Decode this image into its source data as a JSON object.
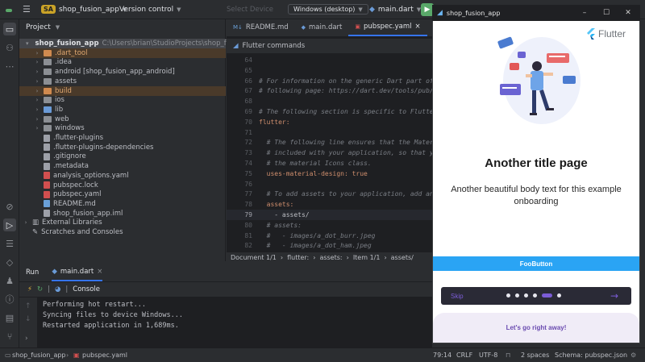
{
  "toolbar": {
    "project_badge": "SA",
    "project_name": "shop_fusion_app",
    "vcs_label": "Version control",
    "device_placeholder": "Select Device",
    "device_selected": "Windows (desktop)",
    "run_config": "main.dart"
  },
  "project_panel": {
    "title": "Project",
    "root_name": "shop_fusion_app",
    "root_path": "C:\\Users\\brian\\StudioProjects\\shop_fusion_app",
    "items": [
      {
        "label": ".dart_tool",
        "type": "folder",
        "color": "orange",
        "expandable": true
      },
      {
        "label": ".idea",
        "type": "folder",
        "color": "grey",
        "expandable": true
      },
      {
        "label": "android [shop_fusion_app_android]",
        "type": "folder",
        "color": "grey",
        "expandable": true
      },
      {
        "label": "assets",
        "type": "folder",
        "color": "grey",
        "expandable": true
      },
      {
        "label": "build",
        "type": "folder",
        "color": "orange",
        "expandable": true
      },
      {
        "label": "ios",
        "type": "folder",
        "color": "grey",
        "expandable": true
      },
      {
        "label": "lib",
        "type": "folder",
        "color": "blue",
        "expandable": true
      },
      {
        "label": "web",
        "type": "folder",
        "color": "grey",
        "expandable": true
      },
      {
        "label": "windows",
        "type": "folder",
        "color": "grey",
        "expandable": true
      },
      {
        "label": ".flutter-plugins",
        "type": "file",
        "color": "grey"
      },
      {
        "label": ".flutter-plugins-dependencies",
        "type": "file",
        "color": "grey"
      },
      {
        "label": ".gitignore",
        "type": "file",
        "color": "grey"
      },
      {
        "label": ".metadata",
        "type": "file",
        "color": "grey"
      },
      {
        "label": "analysis_options.yaml",
        "type": "file",
        "color": "red"
      },
      {
        "label": "pubspec.lock",
        "type": "file",
        "color": "red"
      },
      {
        "label": "pubspec.yaml",
        "type": "file",
        "color": "red"
      },
      {
        "label": "README.md",
        "type": "file",
        "color": "md"
      },
      {
        "label": "shop_fusion_app.iml",
        "type": "file",
        "color": "grey"
      }
    ],
    "external_libraries": "External Libraries",
    "scratches": "Scratches and Consoles"
  },
  "editor": {
    "tabs": [
      {
        "label": "README.md",
        "icon": "markdown-icon",
        "active": false
      },
      {
        "label": "main.dart",
        "icon": "dart-icon",
        "active": false
      },
      {
        "label": "pubspec.yaml",
        "icon": "yaml-icon",
        "active": true
      }
    ],
    "flutter_commands": "Flutter commands",
    "lines": [
      {
        "n": "64",
        "text": "",
        "kind": "plain"
      },
      {
        "n": "65",
        "text": "",
        "kind": "plain"
      },
      {
        "n": "66",
        "text": "# For information on the generic Dart part of",
        "kind": "comment"
      },
      {
        "n": "67",
        "text": "# following page: https://dart.dev/tools/pub/",
        "kind": "comment"
      },
      {
        "n": "68",
        "text": "",
        "kind": "plain"
      },
      {
        "n": "69",
        "text": "# The following section is specific to Flutte",
        "kind": "comment"
      },
      {
        "n": "70",
        "text": "flutter:",
        "kind": "key"
      },
      {
        "n": "71",
        "text": "",
        "kind": "plain"
      },
      {
        "n": "72",
        "text": "  # The following line ensures that the Mater",
        "kind": "comment"
      },
      {
        "n": "73",
        "text": "  # included with your application, so that y",
        "kind": "comment"
      },
      {
        "n": "74",
        "text": "  # the material Icons class.",
        "kind": "comment"
      },
      {
        "n": "75",
        "text": "  uses-material-design: true",
        "kind": "keyval"
      },
      {
        "n": "76",
        "text": "",
        "kind": "plain"
      },
      {
        "n": "77",
        "text": "  # To add assets to your application, add an",
        "kind": "comment"
      },
      {
        "n": "78",
        "text": "  assets:",
        "kind": "key"
      },
      {
        "n": "79",
        "text": "    - assets/",
        "kind": "plain"
      },
      {
        "n": "80",
        "text": "  # assets:",
        "kind": "comment"
      },
      {
        "n": "81",
        "text": "  #   - images/a_dot_burr.jpeg",
        "kind": "comment"
      },
      {
        "n": "82",
        "text": "  #   - images/a_dot_ham.jpeg",
        "kind": "comment"
      }
    ],
    "current_line": "79",
    "breadcrumbs": [
      "Document 1/1",
      "flutter:",
      "assets:",
      "Item 1/1",
      "assets/"
    ]
  },
  "run_panel": {
    "run_label": "Run",
    "config_tab": "main.dart",
    "console_label": "Console",
    "output": [
      "Performing hot restart...",
      "Syncing files to device Windows...",
      "Restarted application in 1,689ms."
    ]
  },
  "statusbar": {
    "project": "shop_fusion_app",
    "file": "pubspec.yaml",
    "position": "79:14",
    "line_ending": "CRLF",
    "encoding": "UTF-8",
    "indent": "2 spaces",
    "schema": "Schema: pubspec.json"
  },
  "app_window": {
    "title": "shop_fusion_app",
    "flutter_brand": "Flutter",
    "page_title": "Another title page",
    "page_body": "Another beautiful body text for this example onboarding",
    "foo_button": "FooButton",
    "skip_label": "Skip",
    "dots_total": 6,
    "dots_active_index": 4,
    "cta_button": "Let's go right away!"
  },
  "colors": {
    "accent": "#3574f0",
    "run_green": "#59a869",
    "foo_button": "#2aa4f4",
    "dot_active": "#7b5cd6",
    "cta_text": "#6a4bb0"
  }
}
